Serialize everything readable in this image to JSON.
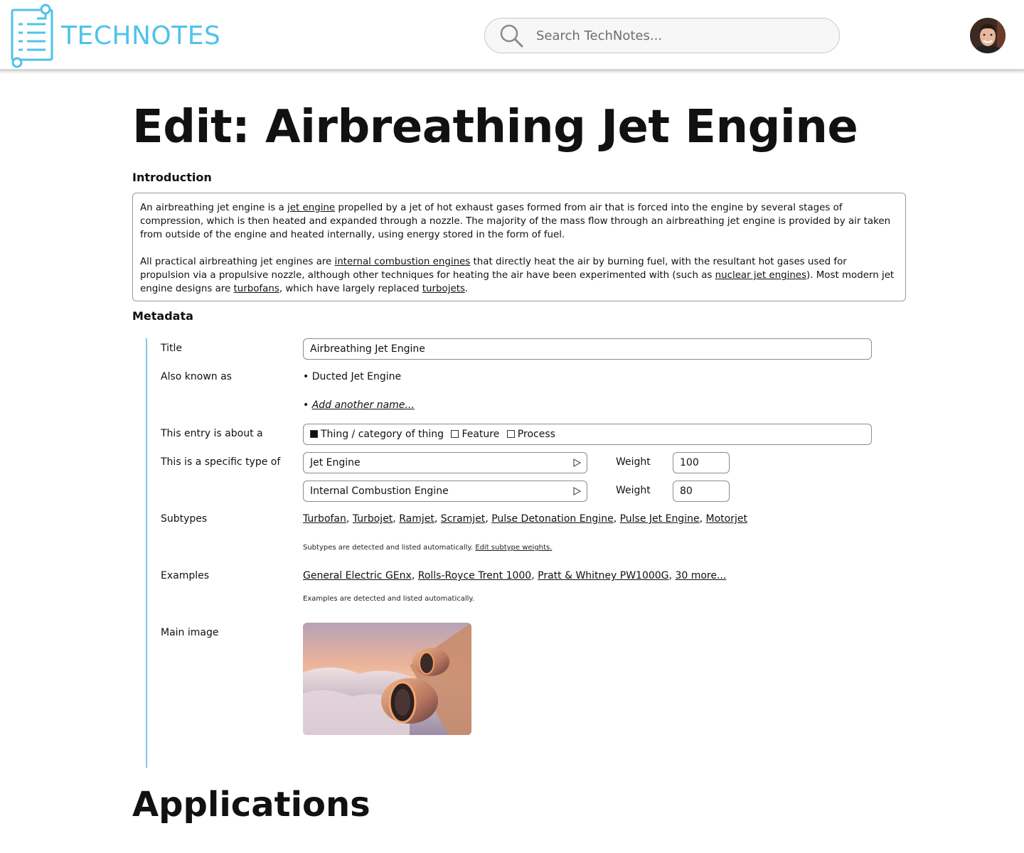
{
  "header": {
    "logo_text": "TECHNOTES",
    "search_placeholder": "Search TechNotes..."
  },
  "page_title": "Edit: Airbreathing Jet Engine",
  "introduction": {
    "label": "Introduction",
    "p1": [
      {
        "text": "An airbreathing jet engine is a "
      },
      {
        "text": "jet engine",
        "link": true
      },
      {
        "text": " propelled by a jet of hot exhaust gases formed from air that is forced into the engine by several stages of compression, which is then heated and expanded through a nozzle. The majority of the mass flow through an airbreathing jet engine is provided by air taken from outside of the engine and heated internally, using energy stored in the form of fuel."
      }
    ],
    "p2": [
      {
        "text": "All practical airbreathing jet engines are "
      },
      {
        "text": "internal combustion engines",
        "link": true
      },
      {
        "text": " that directly heat the air by burning fuel, with the resultant hot gases used for propulsion via a propulsive nozzle, although other techniques for heating the air have been experimented with (such as "
      },
      {
        "text": "nuclear jet engines",
        "link": true
      },
      {
        "text": "). Most modern jet engine designs are "
      },
      {
        "text": "turbofans",
        "link": true
      },
      {
        "text": ", which have largely replaced "
      },
      {
        "text": "turbojets",
        "link": true
      },
      {
        "text": "."
      }
    ]
  },
  "metadata": {
    "label": "Metadata",
    "title_label": "Title",
    "title_value": "Airbreathing Jet Engine",
    "aka_label": "Also known as",
    "aka_items": [
      "• Ducted Jet Engine"
    ],
    "aka_add": "Add another name...",
    "aka_add_bullet": "•",
    "about_label": "This entry is about a",
    "about_options": [
      {
        "label": "Thing / category of thing",
        "checked": true
      },
      {
        "label": "Feature",
        "checked": false
      },
      {
        "label": "Process",
        "checked": false
      }
    ],
    "type_label": "This is a specific type of",
    "weight_label": "Weight",
    "types": [
      {
        "name": "Jet Engine",
        "weight": "100"
      },
      {
        "name": "Internal Combustion Engine",
        "weight": "80"
      }
    ],
    "subtypes_label": "Subtypes",
    "subtypes": [
      "Turbofan",
      "Turbojet",
      "Ramjet",
      "Scramjet",
      "Pulse Detonation Engine",
      "Pulse Jet Engine",
      "Motorjet"
    ],
    "subtypes_note": "Subtypes are detected and listed automatically.",
    "subtypes_note_link": "Edit subtype weights.",
    "examples_label": "Examples",
    "examples": [
      "General Electric GEnx",
      "Rolls-Royce Trent 1000",
      "Pratt & Whitney PW1000G",
      "30 more..."
    ],
    "examples_note": "Examples are detected and listed automatically.",
    "image_label": "Main image"
  },
  "applications_heading": "Applications",
  "colors": {
    "brand": "#4fc3ea",
    "rule": "#7fc8e6"
  },
  "icons": [
    "notes-logo-icon",
    "search-icon",
    "avatar",
    "play-triangle-icon"
  ]
}
